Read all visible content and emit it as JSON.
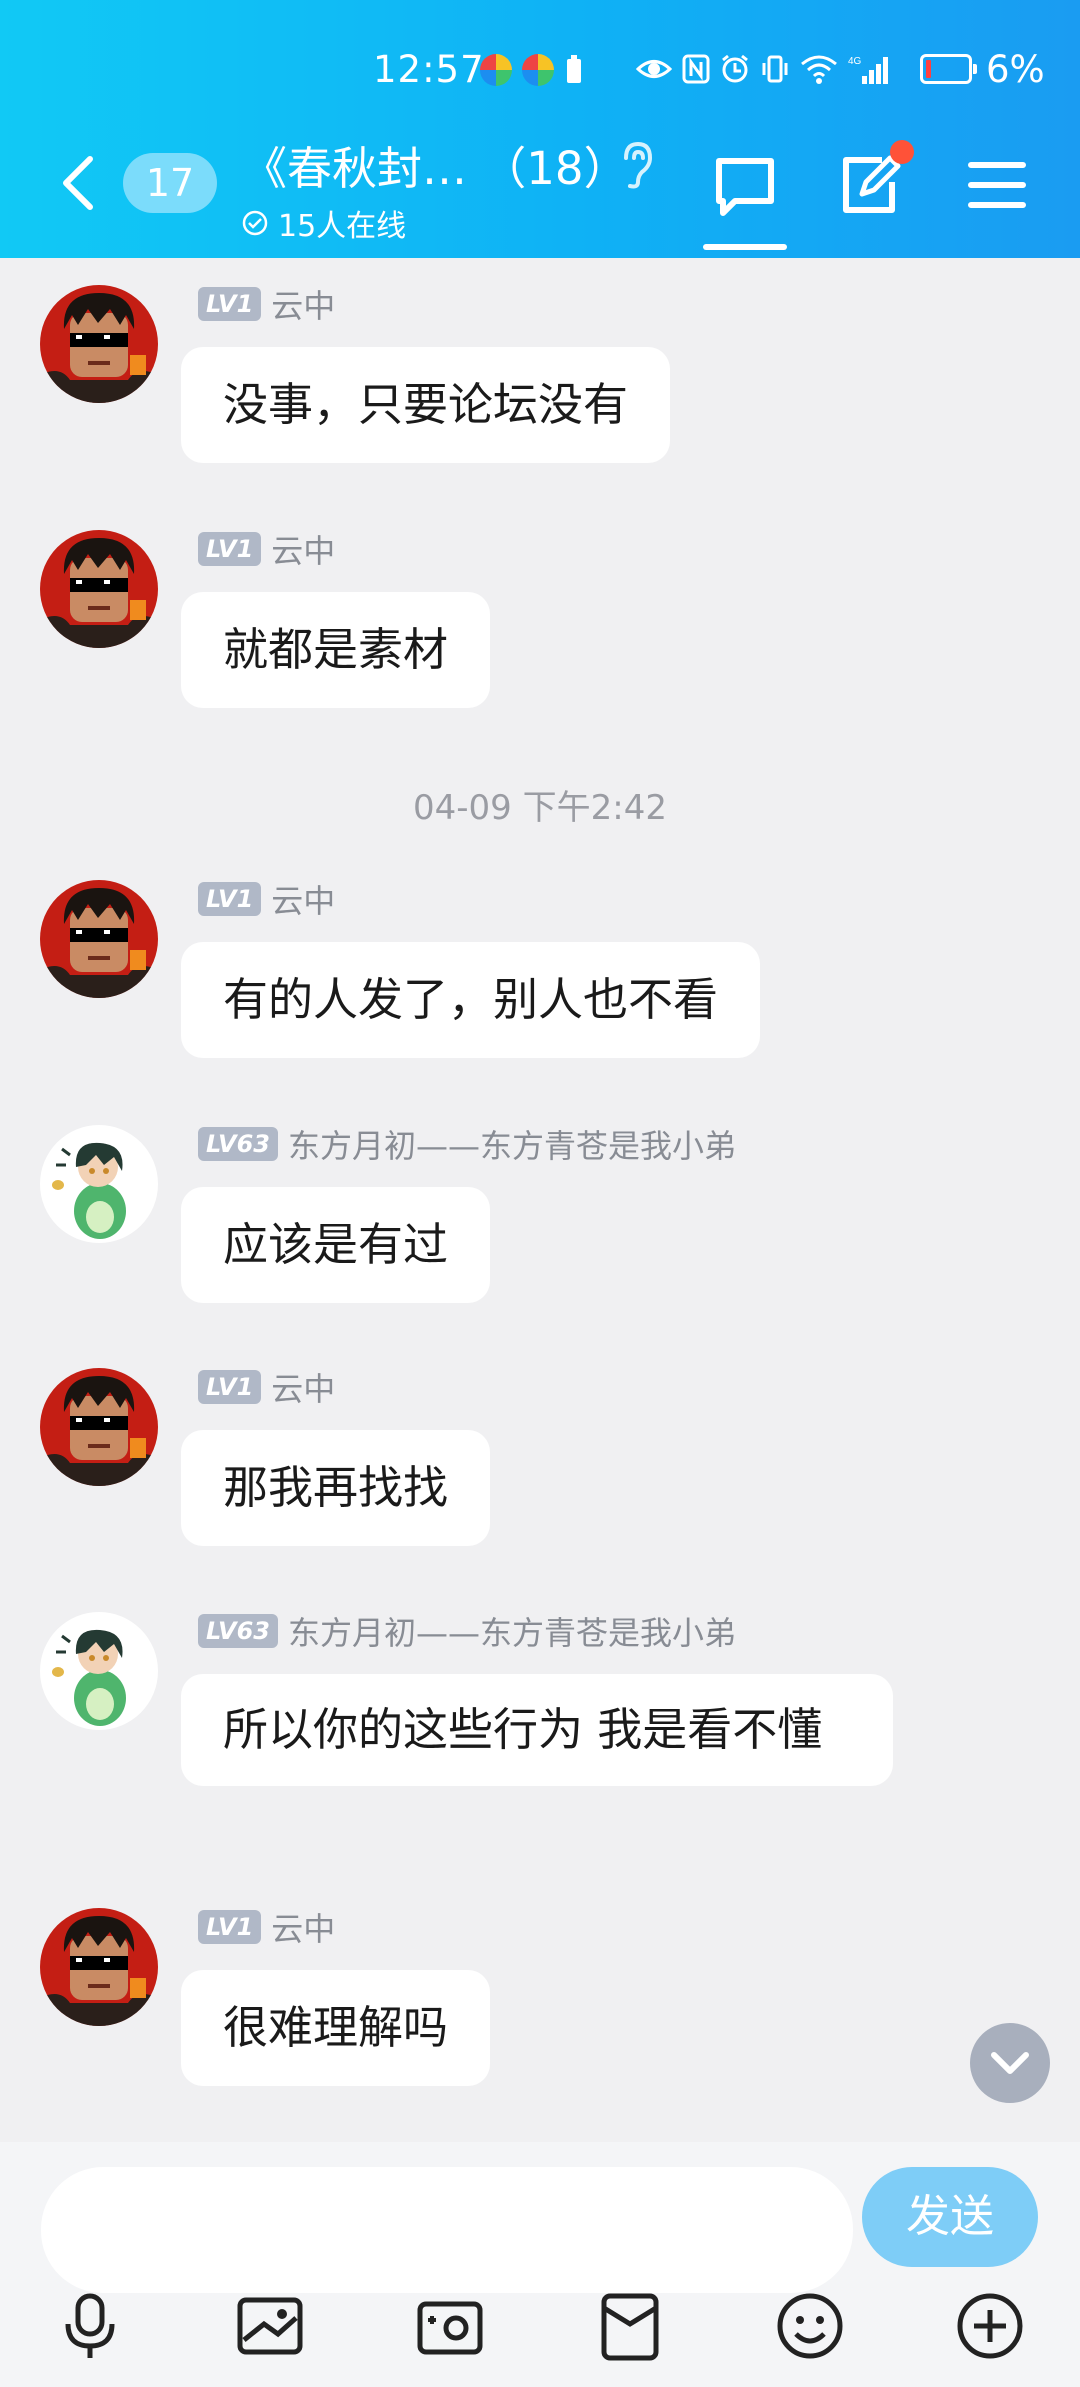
{
  "status_bar": {
    "time": "12:57",
    "battery_percent": "6%"
  },
  "header": {
    "unread_count": "17",
    "title": "《春秋封… （18）",
    "online_text": "15人在线"
  },
  "messages": [
    {
      "level": "LV1",
      "name": "云中",
      "text": "没事，只要论坛没有"
    },
    {
      "level": "LV1",
      "name": "云中",
      "text": "就都是素材"
    },
    {
      "level": "LV1",
      "name": "云中",
      "text": "有的人发了，别人也不看"
    },
    {
      "level": "LV63",
      "name": "东方月初——东方青苍是我小弟",
      "text": "应该是有过"
    },
    {
      "level": "LV1",
      "name": "云中",
      "text": "那我再找找"
    },
    {
      "level": "LV63",
      "name": "东方月初——东方青苍是我小弟",
      "text": "所以你的这些行为  我是看不懂"
    },
    {
      "level": "LV1",
      "name": "云中",
      "text": "很难理解吗"
    }
  ],
  "timestamp": "04-09 下午2:42",
  "input": {
    "placeholder": "",
    "send_label": "发送"
  },
  "colors": {
    "header_start": "#11c9f5",
    "header_end": "#1a9cf2",
    "send_button": "#7ecdf7",
    "notification_dot": "#ff5238"
  },
  "toolbar_icons": [
    "microphone-icon",
    "image-icon",
    "camera-icon",
    "red-packet-icon",
    "emoji-icon",
    "plus-icon"
  ]
}
